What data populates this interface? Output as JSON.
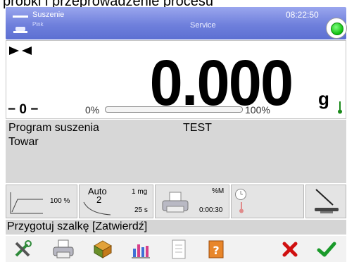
{
  "caption": "próbki i przeprowadzenie procesu",
  "header": {
    "mode_name": "Suszenie",
    "mode_sub": "Pink",
    "service": "Service",
    "time": "08:22:50"
  },
  "weighing": {
    "value": "0.000",
    "unit": "g",
    "zero_marker": "− 0 −",
    "bar_min_label": "0%",
    "bar_max_label": "100%",
    "bar_fill_fraction": 0.0
  },
  "info": {
    "program_label": "Program suszenia",
    "program_value": "TEST",
    "product_label": "Towar"
  },
  "tiles": {
    "profile_value": "100 %",
    "auto_label": "Auto",
    "auto_num": "2",
    "auto_mass": "1 mg",
    "auto_time": "25 s",
    "print_unit": "%M",
    "print_time": "0:00:30"
  },
  "prompt": "Przygotuj szalkę [Zatwierdź]",
  "toolbar": {
    "icons": [
      "tools-icon",
      "printer-icon",
      "database-icon",
      "chart-icon",
      "report-icon",
      "help-icon",
      "cancel-icon",
      "confirm-icon"
    ]
  },
  "colors": {
    "header_bg": "#6f80dc",
    "status_ok": "#0fbf0f",
    "cancel": "#d01010",
    "confirm": "#1a9a2a"
  }
}
